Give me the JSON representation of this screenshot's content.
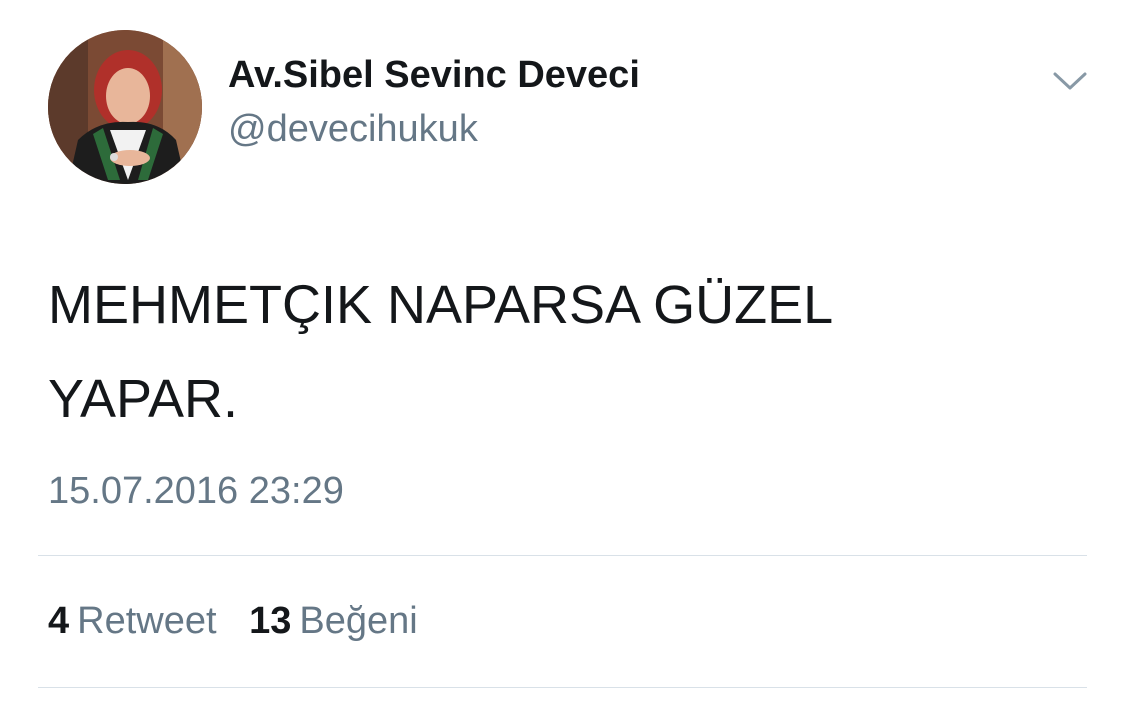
{
  "tweet": {
    "author": {
      "display_name": "Av.Sibel Sevinc Deveci",
      "handle": "@devecihukuk",
      "avatar": "profile-photo"
    },
    "text": "MEHMETÇIK NAPARSA GÜZEL\nYAPAR.",
    "timestamp": "15.07.2016 23:29",
    "stats": {
      "retweets_count": "4",
      "retweets_label": "Retweet",
      "likes_count": "13",
      "likes_label": "Beğeni"
    },
    "menu_icon": "chevron-down-icon"
  },
  "colors": {
    "text_primary": "#14171a",
    "text_secondary": "#657786",
    "divider": "#d9e1e8",
    "background": "#ffffff"
  }
}
